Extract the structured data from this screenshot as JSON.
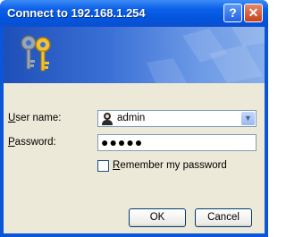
{
  "window": {
    "title": "Connect to 192.168.1.254"
  },
  "titlebar": {
    "help_label": "?",
    "close_label": "✕"
  },
  "form": {
    "username_label": "User name:",
    "username_value": "admin",
    "password_label": "Password:",
    "password_value": "●●●●●",
    "remember_label": "Remember my password",
    "remember_checked": false
  },
  "buttons": {
    "ok_label": "OK",
    "cancel_label": "Cancel"
  },
  "colors": {
    "title_bar": "#0a5fe8",
    "dialog_bg": "#ece9d8",
    "banner": "#3a70d6",
    "close_button": "#c7401b"
  }
}
